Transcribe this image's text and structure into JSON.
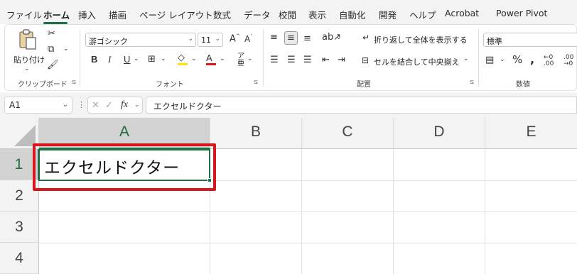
{
  "tabs": [
    "ファイル",
    "ホーム",
    "挿入",
    "描画",
    "ページ レイアウト",
    "数式",
    "データ",
    "校閲",
    "表示",
    "自動化",
    "開発",
    "ヘルプ",
    "Acrobat",
    "Power Pivot"
  ],
  "active_tab": "ホーム",
  "ribbon": {
    "clipboard": {
      "paste_label": "貼り付け",
      "group_label": "クリップボード"
    },
    "font": {
      "font_name": "游ゴシック",
      "font_size": "11",
      "bold": "B",
      "italic": "I",
      "underline": "U",
      "font_color_glyph": "A",
      "group_label": "フォント"
    },
    "alignment": {
      "wrap_text": "折り返して全体を表示する",
      "merge_center": "セルを結合して中央揃え",
      "group_label": "配置"
    },
    "number": {
      "format": "標準",
      "group_label": "数値"
    }
  },
  "formula_bar": {
    "name_box": "A1",
    "fx": "fx",
    "content": "エクセルドクター"
  },
  "grid": {
    "columns": [
      "A",
      "B",
      "C",
      "D",
      "E"
    ],
    "rows": [
      "1",
      "2",
      "3",
      "4"
    ],
    "selected_cell": "A1",
    "cells": {
      "A1": "エクセルドクター"
    }
  },
  "colors": {
    "accent": "#1e7145",
    "highlight": "#d8181e",
    "header_bg": "#f3f3f3"
  },
  "icons": [
    "paste-icon",
    "cut-icon",
    "copy-icon",
    "format-painter-icon",
    "increase-font-icon",
    "decrease-font-icon",
    "borders-icon",
    "fill-color-icon",
    "font-color-icon",
    "phonetic-icon",
    "align-top-icon",
    "align-middle-icon",
    "align-bottom-icon",
    "orientation-icon",
    "align-left-icon",
    "align-center-icon",
    "align-right-icon",
    "decrease-indent-icon",
    "increase-indent-icon",
    "wrap-text-icon",
    "merge-center-icon",
    "accounting-format-icon",
    "percent-icon",
    "comma-style-icon",
    "increase-decimal-icon",
    "decrease-decimal-icon",
    "cancel-icon",
    "enter-icon",
    "insert-function-icon"
  ]
}
